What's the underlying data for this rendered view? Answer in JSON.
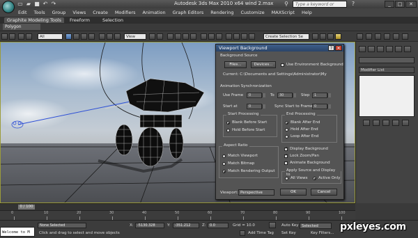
{
  "window": {
    "title": "Autodesk 3ds Max  2010 x64      wind 2.max",
    "search_placeholder": "Type a keyword or phrase"
  },
  "menu": [
    "Edit",
    "Tools",
    "Group",
    "Views",
    "Create",
    "Modifiers",
    "Animation",
    "Graph Editors",
    "Rendering",
    "Customize",
    "MAXScript",
    "Help"
  ],
  "ribbon": {
    "tabs": [
      "Graphite Modeling Tools",
      "Freeform",
      "Selection"
    ],
    "subtab": "Polygon Modeling"
  },
  "toolbar": {
    "filter_value": "All",
    "ref_coord_value": "View",
    "named_selection_value": "Create Selection Se"
  },
  "dialog": {
    "title": "Viewport Background",
    "background_source": {
      "label": "Background Source",
      "files_button": "Files...",
      "devices_button": "Devices...",
      "use_env_label": "Use Environment Background",
      "current_path": "Current: C:\\Documents and Settings\\Administrator\\My"
    },
    "animation_sync": {
      "label": "Animation Synchronization",
      "use_frame_label": "Use Frame",
      "use_frame_value": "0",
      "to_label": "To",
      "to_value": "30",
      "step_label": "Step",
      "step_value": "1",
      "start_at_label": "Start at",
      "start_at_value": "0",
      "sync_start_label": "Sync Start to Frame",
      "sync_start_value": "0"
    },
    "start_processing": {
      "label": "Start Processing",
      "options": [
        "Blank Before Start",
        "Hold Before Start"
      ]
    },
    "end_processing": {
      "label": "End Processing",
      "options": [
        "Blank After End",
        "Hold After End",
        "Loop After End"
      ]
    },
    "aspect_ratio": {
      "label": "Aspect Ratio",
      "options": [
        "Match Viewport",
        "Match Bitmap",
        "Match Rendering Output"
      ]
    },
    "checks": [
      "Display Background",
      "Lock Zoom/Pan",
      "Animate Background"
    ],
    "apply_source": {
      "label": "Apply Source and Display to",
      "options": [
        "All Views",
        "Active Only"
      ]
    },
    "viewport_label": "Viewport:",
    "viewport_value": "Perspective",
    "ok_button": "OK",
    "cancel_button": "Cancel"
  },
  "command_panel": {
    "modifier_list": "Modifier List"
  },
  "timeline": {
    "frame_counter": "0 / 100",
    "ticks": [
      "0",
      "10",
      "20",
      "30",
      "40",
      "50",
      "60",
      "70",
      "80",
      "90",
      "100"
    ]
  },
  "status": {
    "maxscript_text": "Welcome to M",
    "selection_text": "None Selected",
    "prompt_text": "Click and drag to select and move objects",
    "x_label": "X:",
    "x_value": "-5130.328",
    "y_label": "Y:",
    "y_value": "-351.212",
    "z_label": "Z:",
    "z_value": "0.0",
    "grid_text": "Grid = 10.0",
    "add_time_tag": "Add Time Tag",
    "auto_key": "Auto Key",
    "set_key": "Set Key",
    "selected_value": "Selected",
    "key_filters": "Key Filters..."
  },
  "watermark": "pxleyes.com"
}
